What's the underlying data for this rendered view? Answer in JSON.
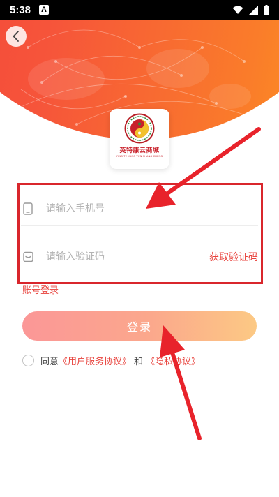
{
  "status_bar": {
    "time": "5:38",
    "notification_icon": "A"
  },
  "header": {
    "back_icon": "chevron-left-icon"
  },
  "logo": {
    "name": "英特康云商城",
    "subtitle": "YING TE KANG YUN SHANG CHENG"
  },
  "form": {
    "phone_placeholder": "请输入手机号",
    "code_placeholder": "请输入验证码",
    "get_code_label": "获取验证码",
    "account_login_label": "账号登录",
    "login_label": "登录"
  },
  "agreement": {
    "prefix": "同意",
    "user_agreement": "《用户服务协议》",
    "and": "和",
    "privacy_agreement": "《隐私协议》"
  },
  "colors": {
    "accent": "#e8413b",
    "header_start": "#f23b3c",
    "header_end": "#ffa31a",
    "annotation": "#d9262c"
  }
}
